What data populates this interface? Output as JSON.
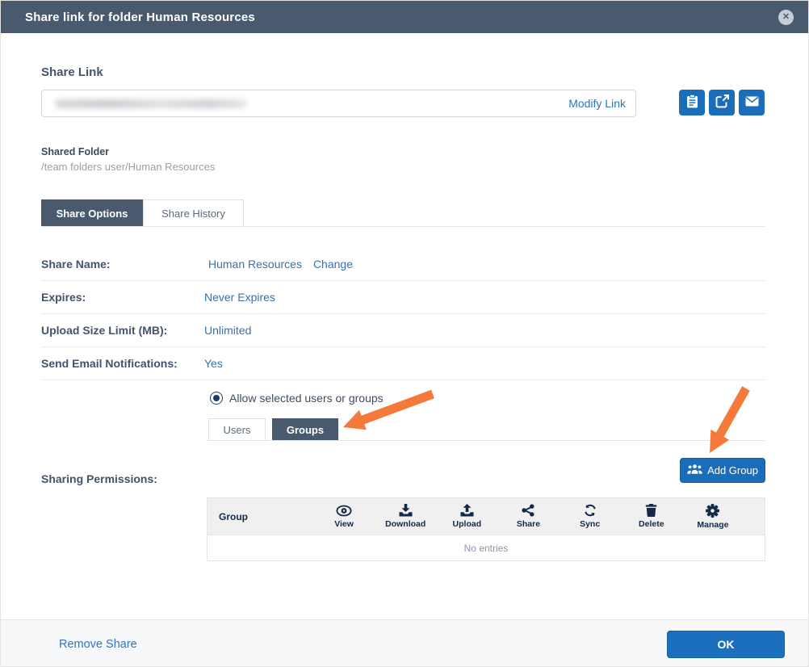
{
  "titlebar": {
    "title": "Share link for folder Human Resources",
    "close_icon": "circle-x-icon"
  },
  "share_link": {
    "label": "Share Link",
    "value_state": "blurred-illegible",
    "modify_link": "Modify Link",
    "action_icons": [
      "clipboard-icon",
      "open-external-icon",
      "envelope-icon"
    ]
  },
  "shared_folder": {
    "label": "Shared Folder",
    "path": "/team folders user/Human Resources"
  },
  "tabs": {
    "items": [
      {
        "label": "Share Options",
        "active": true
      },
      {
        "label": "Share History",
        "active": false
      }
    ]
  },
  "options": {
    "rows": [
      {
        "label": "Share Name:",
        "value": "Human Resources",
        "action": "Change"
      },
      {
        "label": "Expires:",
        "value": "Never Expires"
      },
      {
        "label": "Upload Size Limit (MB):",
        "value": "Unlimited"
      },
      {
        "label": "Send Email Notifications:",
        "value": "Yes"
      }
    ],
    "radio": {
      "label": "Allow selected users or groups",
      "selected": true
    },
    "subtabs": [
      {
        "label": "Users",
        "active": false
      },
      {
        "label": "Groups",
        "active": true
      }
    ]
  },
  "permissions": {
    "label": "Sharing Permissions:",
    "add_group_button": {
      "label": "Add Group",
      "icon": "user-group-icon"
    },
    "table": {
      "columns": [
        {
          "label": "Group",
          "icon": null
        },
        {
          "label": "View",
          "icon": "eye-icon"
        },
        {
          "label": "Download",
          "icon": "download-icon"
        },
        {
          "label": "Upload",
          "icon": "upload-icon"
        },
        {
          "label": "Share",
          "icon": "share-nodes-icon"
        },
        {
          "label": "Sync",
          "icon": "sync-icon"
        },
        {
          "label": "Delete",
          "icon": "trash-icon"
        },
        {
          "label": "Manage",
          "icon": "gear-icon"
        }
      ],
      "empty_text": "No entries"
    }
  },
  "annotations": [
    {
      "icon": "orange-arrow",
      "points_to": "Groups tab"
    },
    {
      "icon": "orange-arrow",
      "points_to": "Add Group button"
    }
  ],
  "footer": {
    "remove_share": "Remove Share",
    "ok": "OK"
  },
  "colors": {
    "titlebar": "#4a5a6e",
    "accent_blue": "#1a6db9",
    "link_blue": "#2d74c4",
    "value_blue": "#3a70ab",
    "arrow_orange": "#f4793a",
    "icon_navy": "#13294a",
    "table_header_bg": "#f0f0f1"
  }
}
